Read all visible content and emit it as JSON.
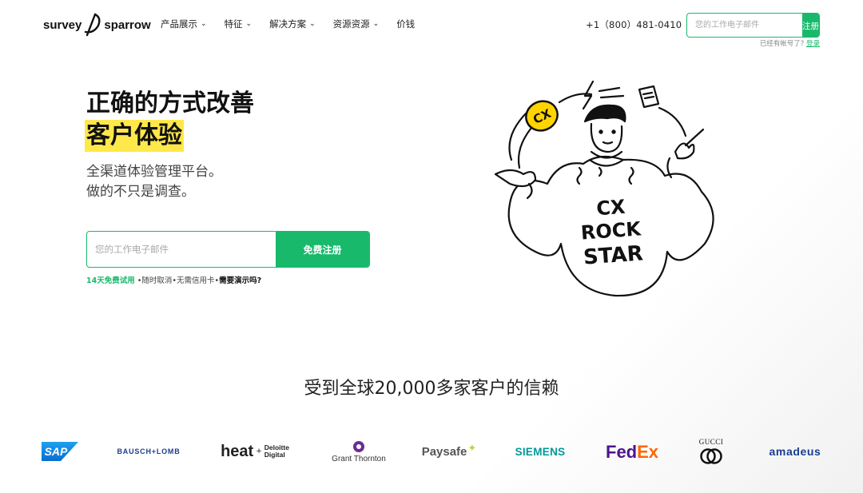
{
  "header": {
    "brand": {
      "left": "survey",
      "right": "sparrow"
    },
    "nav": [
      {
        "label": "产品展示",
        "chevron": true
      },
      {
        "label": "特征",
        "chevron": true
      },
      {
        "label": "解决方案",
        "chevron": true
      },
      {
        "label": "资源资源",
        "chevron": true
      },
      {
        "label": "价钱",
        "chevron": false
      }
    ],
    "phone": "+1（800）481-0410",
    "email_placeholder": "您的工作电子邮件",
    "signup_label": "注册",
    "have_account": "已经有帐号了?",
    "login_label": "登录"
  },
  "hero": {
    "title_line1": "正确的方式改善",
    "title_line2": "客户体验",
    "subtitle_line1": "全渠道体验管理平台。",
    "subtitle_line2": "做的不只是调查。",
    "email_placeholder": "您的工作电子邮件",
    "cta_label": "免费注册",
    "trial_text": "14天免费试用",
    "perks": " •随时取消•无需信用卡•",
    "demo_label": "需要演示吗?",
    "illustration_text": [
      "CX",
      "ROCK",
      "STAR"
    ],
    "badge_text": "CX"
  },
  "trust": {
    "title": "受到全球20,000多家客户的信赖",
    "logos": [
      "SAP",
      "BAUSCH+LOMB",
      "heat",
      "+",
      "Deloitte",
      "Digital",
      "Grant Thornton",
      "Paysafe",
      "SIEMENS",
      "FedEx",
      "GUCCI",
      "amadeus"
    ]
  },
  "colors": {
    "accent": "#19b96b",
    "highlight": "#ffe84a",
    "badge": "#ffd400"
  }
}
